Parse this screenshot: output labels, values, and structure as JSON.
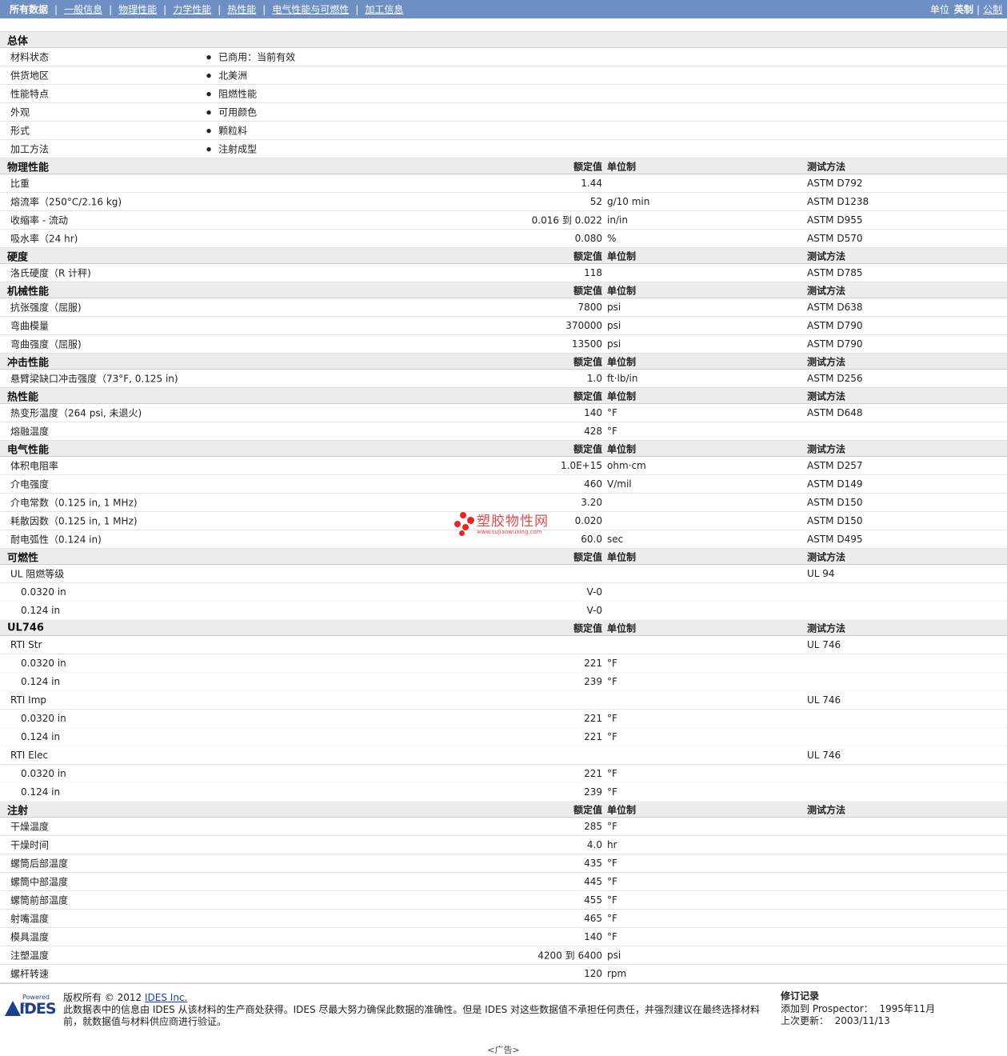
{
  "nav": {
    "items": [
      {
        "label": "所有数据",
        "active": true
      },
      {
        "label": "一般信息"
      },
      {
        "label": "物理性能"
      },
      {
        "label": "力学性能"
      },
      {
        "label": "热性能"
      },
      {
        "label": "电气性能与可燃性"
      },
      {
        "label": "加工信息"
      }
    ]
  },
  "units": {
    "label": "单位",
    "current": "英制",
    "other": "公制"
  },
  "sections": [
    {
      "title": "总体",
      "cols": false,
      "rows": [
        {
          "name": "材料状态",
          "bullet": "已商用：当前有效"
        },
        {
          "name": "供货地区",
          "bullet": "北美洲"
        },
        {
          "name": "性能特点",
          "bullet": "阻燃性能"
        },
        {
          "name": "外观",
          "bullet": "可用颜色"
        },
        {
          "name": "形式",
          "bullet": "颗粒料"
        },
        {
          "name": "加工方法",
          "bullet": "注射成型"
        }
      ]
    },
    {
      "title": "物理性能",
      "cols": true,
      "rows": [
        {
          "name": "比重",
          "value": "1.44",
          "unit": "",
          "method": "ASTM D792"
        },
        {
          "name": "熔流率（250°C/2.16 kg)",
          "value": "52",
          "unit": "g/10 min",
          "method": "ASTM D1238"
        },
        {
          "name": "收缩率 - 流动",
          "value": "0.016 到  0.022",
          "unit": "in/in",
          "method": "ASTM D955"
        },
        {
          "name": "吸水率（24 hr)",
          "value": "0.080",
          "unit": "%",
          "method": "ASTM D570"
        }
      ]
    },
    {
      "title": "硬度",
      "cols": true,
      "rows": [
        {
          "name": "洛氏硬度（R 计秤)",
          "value": "118",
          "unit": "",
          "method": "ASTM D785"
        }
      ]
    },
    {
      "title": "机械性能",
      "cols": true,
      "rows": [
        {
          "name": "抗张强度（屈服)",
          "value": "7800",
          "unit": "psi",
          "method": "ASTM D638"
        },
        {
          "name": "弯曲模量",
          "value": "370000",
          "unit": "psi",
          "method": "ASTM D790"
        },
        {
          "name": "弯曲强度（屈服)",
          "value": "13500",
          "unit": "psi",
          "method": "ASTM D790"
        }
      ]
    },
    {
      "title": "冲击性能",
      "cols": true,
      "rows": [
        {
          "name": "悬臂梁缺口冲击强度（73°F, 0.125 in)",
          "value": "1.0",
          "unit": "ft·lb/in",
          "method": "ASTM D256"
        }
      ]
    },
    {
      "title": "热性能",
      "cols": true,
      "rows": [
        {
          "name": "热变形温度（264 psi, 未退火)",
          "value": "140",
          "unit": "°F",
          "method": "ASTM D648"
        },
        {
          "name": "熔融温度",
          "value": "428",
          "unit": "°F",
          "method": ""
        }
      ]
    },
    {
      "title": "电气性能",
      "cols": true,
      "rows": [
        {
          "name": "体积电阻率",
          "value": "1.0E+15",
          "unit": "ohm·cm",
          "method": "ASTM D257"
        },
        {
          "name": "介电强度",
          "value": "460",
          "unit": "V/mil",
          "method": "ASTM D149"
        },
        {
          "name": "介电常数（0.125 in, 1 MHz)",
          "value": "3.20",
          "unit": "",
          "method": "ASTM D150"
        },
        {
          "name": "耗散因数（0.125 in, 1 MHz)",
          "value": "0.020",
          "unit": "",
          "method": "ASTM D150"
        },
        {
          "name": "耐电弧性（0.124 in)",
          "value": "60.0",
          "unit": "sec",
          "method": "ASTM D495"
        }
      ]
    },
    {
      "title": "可燃性",
      "cols": true,
      "rows": [
        {
          "name": "UL 阻燃等级",
          "value": "",
          "unit": "",
          "method": "UL 94"
        },
        {
          "name": "0.0320 in",
          "value": "V-0",
          "unit": "",
          "method": "",
          "sub": true
        },
        {
          "name": "0.124 in",
          "value": "V-0",
          "unit": "",
          "method": "",
          "sub": true
        }
      ]
    },
    {
      "title": "UL746",
      "cols": true,
      "rows": [
        {
          "name": "RTI Str",
          "value": "",
          "unit": "",
          "method": "UL 746"
        },
        {
          "name": "0.0320 in",
          "value": "221",
          "unit": "°F",
          "method": "",
          "sub": true
        },
        {
          "name": "0.124 in",
          "value": "239",
          "unit": "°F",
          "method": "",
          "sub": true
        },
        {
          "name": "RTI Imp",
          "value": "",
          "unit": "",
          "method": "UL 746"
        },
        {
          "name": "0.0320 in",
          "value": "221",
          "unit": "°F",
          "method": "",
          "sub": true
        },
        {
          "name": "0.124 in",
          "value": "221",
          "unit": "°F",
          "method": "",
          "sub": true
        },
        {
          "name": "RTI Elec",
          "value": "",
          "unit": "",
          "method": "UL 746"
        },
        {
          "name": "0.0320 in",
          "value": "221",
          "unit": "°F",
          "method": "",
          "sub": true
        },
        {
          "name": "0.124 in",
          "value": "239",
          "unit": "°F",
          "method": "",
          "sub": true
        }
      ]
    },
    {
      "title": "注射",
      "cols": true,
      "rows": [
        {
          "name": "干燥温度",
          "value": "285",
          "unit": "°F",
          "method": ""
        },
        {
          "name": "干燥时间",
          "value": "4.0",
          "unit": "hr",
          "method": ""
        },
        {
          "name": "螺筒后部温度",
          "value": "435",
          "unit": "°F",
          "method": ""
        },
        {
          "name": "螺筒中部温度",
          "value": "445",
          "unit": "°F",
          "method": ""
        },
        {
          "name": "螺筒前部温度",
          "value": "455",
          "unit": "°F",
          "method": ""
        },
        {
          "name": "射嘴温度",
          "value": "465",
          "unit": "°F",
          "method": ""
        },
        {
          "name": "模具温度",
          "value": "140",
          "unit": "°F",
          "method": ""
        },
        {
          "name": "注塑温度",
          "value": "4200 到  6400",
          "unit": "psi",
          "method": ""
        },
        {
          "name": "螺杆转速",
          "value": "120",
          "unit": "rpm",
          "method": ""
        }
      ]
    }
  ],
  "col_headers": {
    "value": "额定值",
    "unit": "单位制",
    "method": "测试方法"
  },
  "watermark": {
    "cn": "塑胶物性网",
    "url": "www.sujiaowuxing.com"
  },
  "footer": {
    "logo_powered": "Powered by",
    "logo_text": "IDES",
    "copyright_prefix": "版权所有  © 2012 ",
    "copyright_link": "IDES Inc.",
    "disclaimer": "此数据表中的信息由  IDES 从该材料的生产商处获得。IDES 尽最大努力确保此数据的准确性。但是  IDES 对这些数据值不承担任何责任，并强烈建议在最终选择材料前，就数据值与材料供应商进行验证。",
    "revision_title": "修订记录",
    "added_label": "添加到  Prospector：",
    "added_value": "1995年11月",
    "updated_label": "上次更新：",
    "updated_value": "2003/11/13",
    "ad": "<广告>"
  }
}
